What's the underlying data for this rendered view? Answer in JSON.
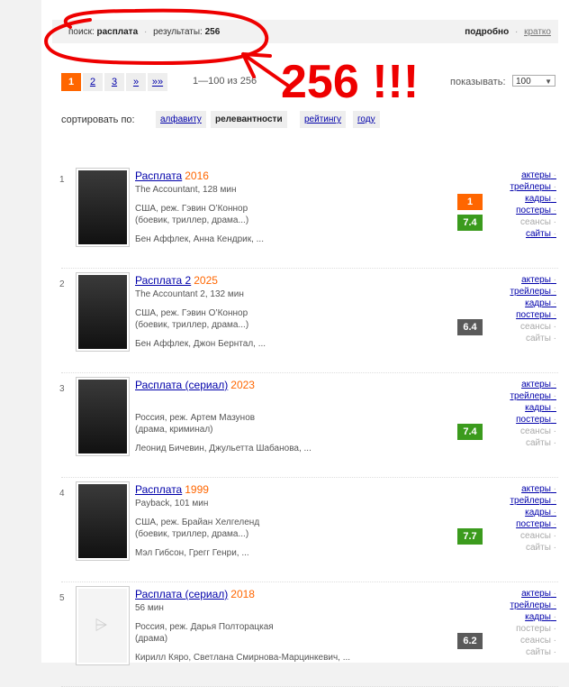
{
  "search": {
    "label": "поиск:",
    "query": "расплата",
    "results_label": "результаты:",
    "results_count": "256",
    "view_full": "подробно",
    "view_short": "кратко"
  },
  "pager": {
    "pages": [
      "1",
      "2",
      "3",
      "»",
      "»»"
    ],
    "active": "1",
    "range": "1—100 из 256",
    "show_label": "показывать:",
    "show_value": "100"
  },
  "sort": {
    "label": "сортировать по:",
    "options": [
      "алфавиту",
      "релевантности",
      "рейтингу",
      "году"
    ],
    "current": "релевантности"
  },
  "annotation": "256 !!!",
  "films": [
    {
      "num": "1",
      "title": "Расплата",
      "year": "2016",
      "orig": "The Accountant, 128 мин",
      "info1": "США, реж. Гэвин О’Коннор",
      "info2": "(боевик, триллер, драма...)",
      "actors": "Бен Аффлек, Анна Кендрик, ...",
      "user_rating": "1",
      "rating": "7.4",
      "rating_color": "green",
      "links": [
        {
          "t": "актеры",
          "on": true
        },
        {
          "t": "трейлеры",
          "on": true
        },
        {
          "t": "кадры",
          "on": true
        },
        {
          "t": "постеры",
          "on": true
        },
        {
          "t": "сеансы",
          "on": false
        },
        {
          "t": "сайты",
          "on": true
        }
      ]
    },
    {
      "num": "2",
      "title": "Расплата 2",
      "year": "2025",
      "orig": "The Accountant 2, 132 мин",
      "info1": "США, реж. Гэвин О’Коннор",
      "info2": "(боевик, триллер, драма...)",
      "actors": "Бен Аффлек, Джон Бернтал, ...",
      "rating": "6.4",
      "rating_color": "gray",
      "links": [
        {
          "t": "актеры",
          "on": true
        },
        {
          "t": "трейлеры",
          "on": true
        },
        {
          "t": "кадры",
          "on": true
        },
        {
          "t": "постеры",
          "on": true
        },
        {
          "t": "сеансы",
          "on": false
        },
        {
          "t": "сайты",
          "on": false
        }
      ]
    },
    {
      "num": "3",
      "title": "Расплата (сериал)",
      "year": "2023",
      "orig": "",
      "info1": "Россия, реж. Артем Мазунов",
      "info2": "(драма, криминал)",
      "actors": "Леонид Бичевин, Джульетта Шабанова, ...",
      "rating": "7.4",
      "rating_color": "green",
      "links": [
        {
          "t": "актеры",
          "on": true
        },
        {
          "t": "трейлеры",
          "on": true
        },
        {
          "t": "кадры",
          "on": true
        },
        {
          "t": "постеры",
          "on": true
        },
        {
          "t": "сеансы",
          "on": false
        },
        {
          "t": "сайты",
          "on": false
        }
      ]
    },
    {
      "num": "4",
      "title": "Расплата",
      "year": "1999",
      "orig": "Payback, 101 мин",
      "info1": "США, реж. Брайан Хелгеленд",
      "info2": "(боевик, триллер, драма...)",
      "actors": "Мэл Гибсон, Грегг Генри, ...",
      "rating": "7.7",
      "rating_color": "green",
      "links": [
        {
          "t": "актеры",
          "on": true
        },
        {
          "t": "трейлеры",
          "on": true
        },
        {
          "t": "кадры",
          "on": true
        },
        {
          "t": "постеры",
          "on": true
        },
        {
          "t": "сеансы",
          "on": false
        },
        {
          "t": "сайты",
          "on": false
        }
      ]
    },
    {
      "num": "5",
      "title": "Расплата (сериал)",
      "year": "2018",
      "orig": "56 мин",
      "info1": "Россия, реж. Дарья Полторацкая",
      "info2": "(драма)",
      "actors": "Кирилл Кяро, Светлана Смирнова-Марцинкевич, ...",
      "rating": "6.2",
      "rating_color": "gray",
      "links": [
        {
          "t": "актеры",
          "on": true
        },
        {
          "t": "трейлеры",
          "on": true
        },
        {
          "t": "кадры",
          "on": true
        },
        {
          "t": "постеры",
          "on": false
        },
        {
          "t": "сеансы",
          "on": false
        },
        {
          "t": "сайты",
          "on": false
        }
      ]
    }
  ]
}
